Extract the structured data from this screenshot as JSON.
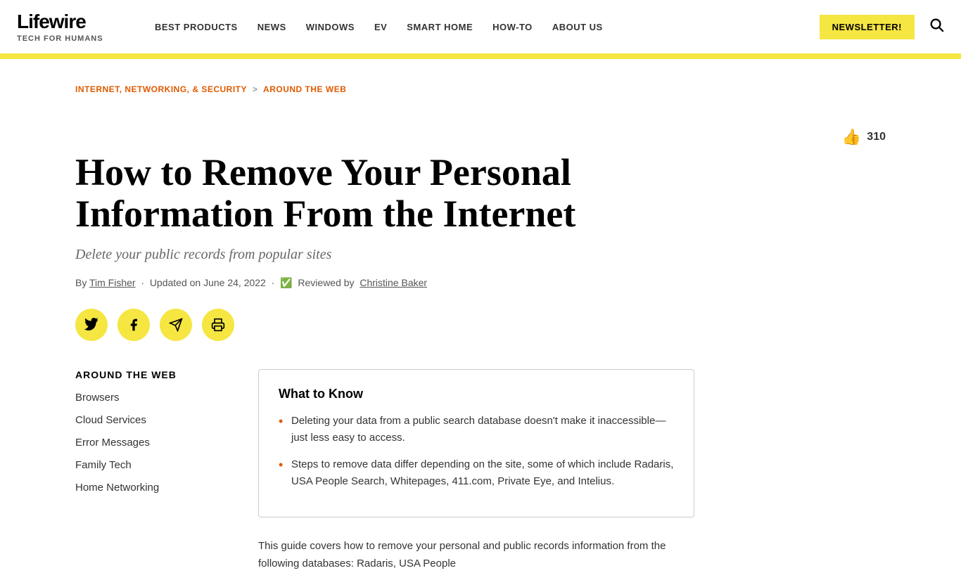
{
  "header": {
    "logo": "Lifewire",
    "tagline": "TECH FOR HUMANS",
    "nav": [
      {
        "label": "BEST PRODUCTS",
        "id": "best-products"
      },
      {
        "label": "NEWS",
        "id": "news"
      },
      {
        "label": "WINDOWS",
        "id": "windows"
      },
      {
        "label": "EV",
        "id": "ev"
      },
      {
        "label": "SMART HOME",
        "id": "smart-home"
      },
      {
        "label": "HOW-TO",
        "id": "how-to"
      },
      {
        "label": "ABOUT US",
        "id": "about-us"
      }
    ],
    "newsletter_label": "NEWSLETTER!",
    "search_label": "search"
  },
  "breadcrumb": {
    "parent": "INTERNET, NETWORKING, & SECURITY",
    "separator": ">",
    "current": "AROUND THE WEB"
  },
  "like_count": "310",
  "article": {
    "title": "How to Remove Your Personal Information From the Internet",
    "subtitle": "Delete your public records from popular sites",
    "byline": "By",
    "author": "Tim Fisher",
    "updated": "Updated on June 24, 2022",
    "reviewed_by_label": "Reviewed by",
    "reviewer": "Christine Baker"
  },
  "social": {
    "twitter_label": "twitter",
    "facebook_label": "facebook",
    "email_label": "email",
    "print_label": "print"
  },
  "sidebar": {
    "section_title": "AROUND THE WEB",
    "links": [
      {
        "label": "Browsers"
      },
      {
        "label": "Cloud Services"
      },
      {
        "label": "Error Messages"
      },
      {
        "label": "Family Tech"
      },
      {
        "label": "Home Networking"
      }
    ]
  },
  "what_to_know": {
    "title": "What to Know",
    "points": [
      "Deleting your data from a public search database doesn't make it inaccessible—just less easy to access.",
      "Steps to remove data differ depending on the site, some of which include Radaris, USA People Search, Whitepages, 411.com, Private Eye, and Intelius."
    ]
  },
  "article_body": "This guide covers how to remove your personal and public records information from the following databases: Radaris, USA People"
}
